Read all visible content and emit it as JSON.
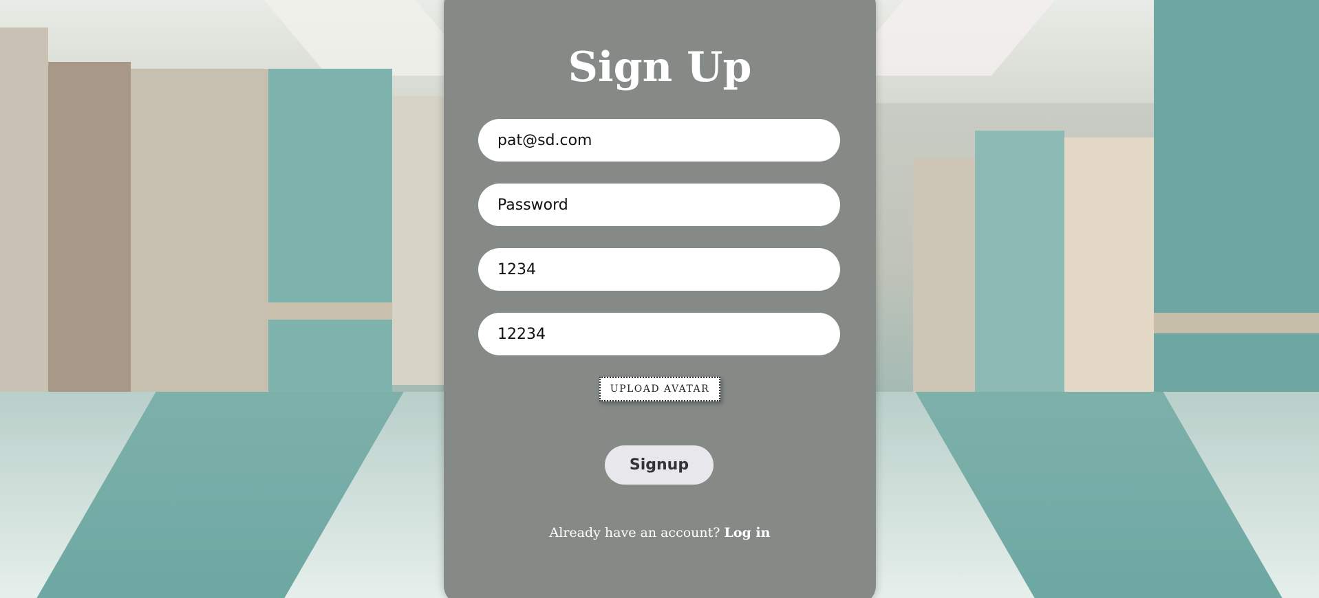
{
  "form": {
    "title": "Sign Up",
    "fields": [
      {
        "value": "pat@sd.com",
        "placeholder": ""
      },
      {
        "value": "",
        "placeholder": "Password"
      },
      {
        "value": "1234",
        "placeholder": ""
      },
      {
        "value": "12234",
        "placeholder": ""
      }
    ],
    "upload_label": "UPLOAD AVATAR",
    "submit_label": "Signup",
    "login_prompt": "Already have an account?",
    "login_link": "Log in"
  }
}
